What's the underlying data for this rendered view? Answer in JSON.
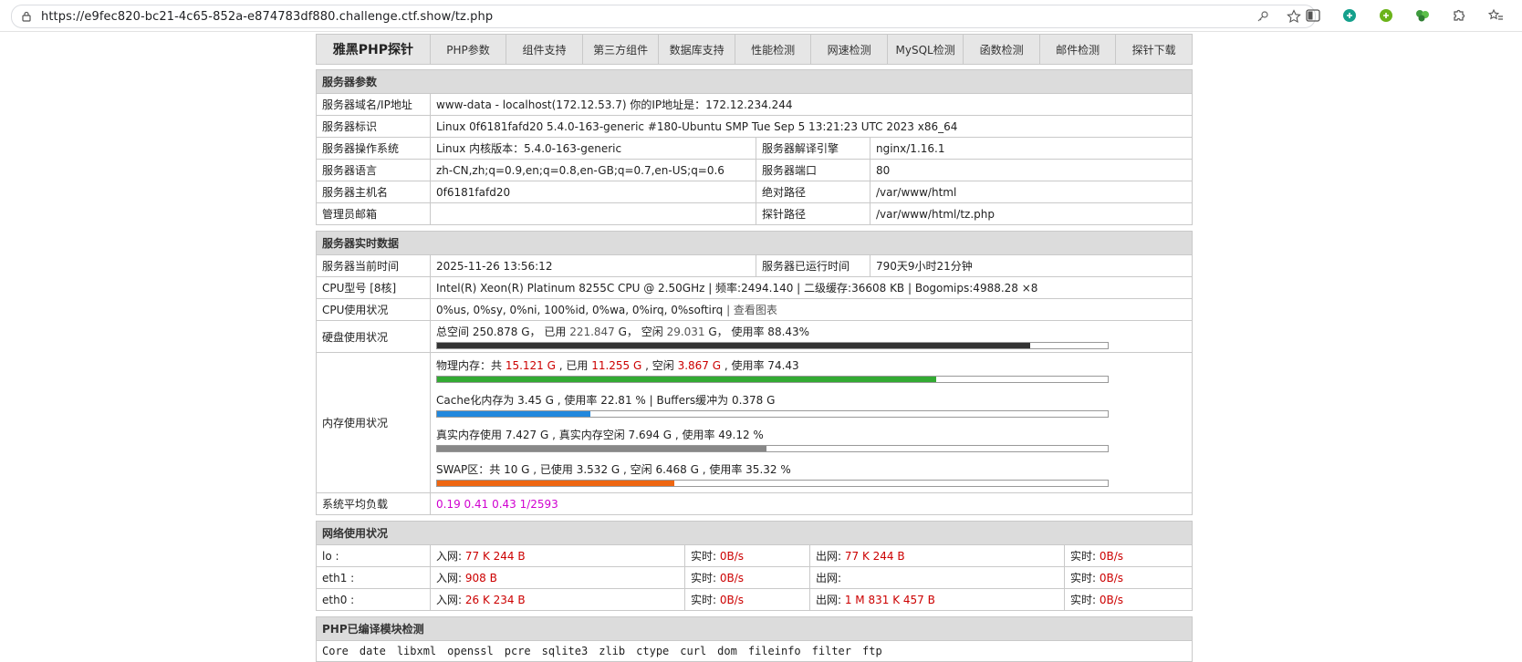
{
  "browser": {
    "url": "https://e9fec820-bc21-4c65-852a-e874783df880.challenge.ctf.show/tz.php"
  },
  "nav": [
    "雅黑PHP探针",
    "PHP参数",
    "组件支持",
    "第三方组件",
    "数据库支持",
    "性能检测",
    "网速检测",
    "MySQL检测",
    "函数检测",
    "邮件检测",
    "探针下载"
  ],
  "server_params": {
    "title": "服务器参数",
    "rows": [
      {
        "label": "服务器域名/IP地址",
        "value": "www-data - localhost(172.12.53.7)  你的IP地址是：172.12.234.244"
      },
      {
        "label": "服务器标识",
        "value": "Linux 0f6181fafd20 5.4.0-163-generic #180-Ubuntu SMP Tue Sep 5 13:21:23 UTC 2023 x86_64"
      },
      {
        "label": "服务器操作系统",
        "value": "Linux  内核版本：5.4.0-163-generic",
        "label2": "服务器解译引擎",
        "value2": "nginx/1.16.1"
      },
      {
        "label": "服务器语言",
        "value": "zh-CN,zh;q=0.9,en;q=0.8,en-GB;q=0.7,en-US;q=0.6",
        "label2": "服务器端口",
        "value2": "80"
      },
      {
        "label": "服务器主机名",
        "value": "0f6181fafd20",
        "label2": "绝对路径",
        "value2": "/var/www/html"
      },
      {
        "label": "管理员邮箱",
        "value": "",
        "label2": "探针路径",
        "value2": "/var/www/html/tz.php"
      }
    ]
  },
  "realtime": {
    "title": "服务器实时数据",
    "time_label": "服务器当前时间",
    "time_value": "2025-11-26 13:56:12",
    "uptime_label": "服务器已运行时间",
    "uptime_value": "790天9小时21分钟",
    "cpu_label": "CPU型号 [8核]",
    "cpu_value": "Intel(R) Xeon(R) Platinum 8255C CPU @ 2.50GHz | 频率:2494.140 | 二级缓存:36608 KB | Bogomips:4988.28 ×8",
    "cpu_usage_label": "CPU使用状况",
    "cpu_usage_value": "0%us, 0%sy, 0%ni, 100%id, 0%wa, 0%irq, 0%softirq",
    "cpu_chart_link": "| 查看图表",
    "disk_label": "硬盘使用状况",
    "disk_text_1": "总空间 250.878 G，  已用 ",
    "disk_used": "221.847",
    "disk_text_2": " G，  空闲 ",
    "disk_free": "29.031",
    "disk_text_3": " G，  使用率 88.43%",
    "disk_pct": 88.43,
    "mem_label": "内存使用状况",
    "mem_phys": {
      "t1": "物理内存：共 ",
      "total": "15.121 G",
      "t2": " , 已用 ",
      "used": "11.255 G",
      "t3": " , 空闲 ",
      "free": "3.867 G",
      "t4": " , 使用率 74.43",
      "pct": 74.43
    },
    "mem_cache": {
      "text": "Cache化内存为 3.45 G , 使用率 22.81 % | Buffers缓冲为 0.378 G",
      "pct": 22.81
    },
    "mem_real": {
      "text": "真实内存使用 7.427 G , 真实内存空闲 7.694 G , 使用率 49.12 %",
      "pct": 49.12
    },
    "mem_swap": {
      "text": "SWAP区：共 10 G , 已使用 3.532 G , 空闲 6.468 G , 使用率 35.32 %",
      "pct": 35.32
    },
    "load_label": "系统平均负载",
    "load_value": "0.19 0.41 0.43 1/2593",
    "colors": {
      "disk": "#333333",
      "phys": "#33aa33",
      "cache": "#2288dd",
      "real": "#888888",
      "swap": "#ee6611"
    }
  },
  "network": {
    "title": "网络使用状况",
    "in_label": "入网: ",
    "out_label": "出网: ",
    "rt_label": "实时: ",
    "rows": [
      {
        "iface": "lo :",
        "in": "77 K 244 B",
        "rt_in": "0B/s",
        "out": "77 K 244 B",
        "rt_out": "0B/s"
      },
      {
        "iface": "eth1 :",
        "in": "908 B",
        "rt_in": "0B/s",
        "out": "",
        "rt_out": "0B/s"
      },
      {
        "iface": "eth0 :",
        "in": "26 K 234 B",
        "rt_in": "0B/s",
        "out": "1 M 831 K 457 B",
        "rt_out": "0B/s"
      }
    ]
  },
  "modules": {
    "title": "PHP已编译模块检测",
    "list": [
      "Core",
      "date",
      "libxml",
      "openssl",
      "pcre",
      "sqlite3",
      "zlib",
      "ctype",
      "curl",
      "dom",
      "fileinfo",
      "filter",
      "ftp"
    ]
  }
}
